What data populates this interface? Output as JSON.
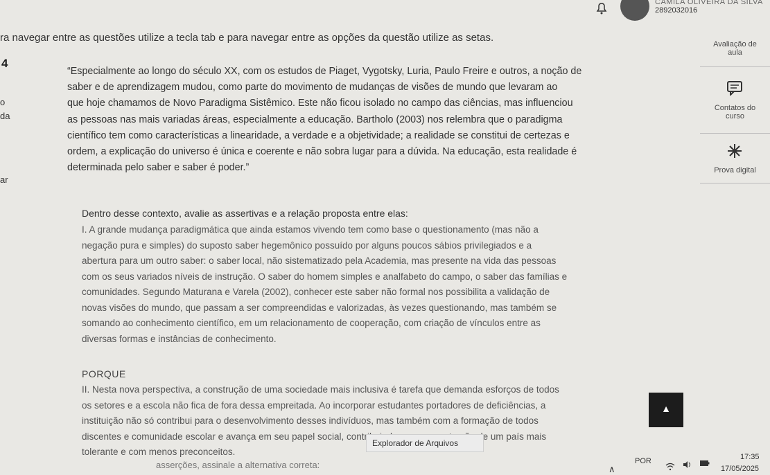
{
  "header": {
    "user_name": "CAMILA OLIVEIRA DA SILVA",
    "user_id": "2892032016"
  },
  "instructions": "ra navegar entre as questões utilize a tecla tab e para navegar entre as opções da questão utilize as setas.",
  "left_partial_labels": [
    "o",
    "da",
    "ar"
  ],
  "question": {
    "number": "4",
    "quote_lines": [
      "“Especialmente ao longo do século XX, com os estudos de Piaget, Vygotsky, Luria, Paulo Freire e outros, a noção de",
      "saber e de aprendizagem mudou, como parte do movimento de mudanças de visões de mundo que levaram ao",
      "que hoje chamamos de Novo Paradigma Sistêmico. Este não ficou isolado no campo das ciências, mas influenciou",
      "as pessoas nas mais variadas áreas, especialmente a educação. Bartholo (2003) nos relembra que o paradigma",
      "científico tem como características a linearidade, a verdade e a objetividade; a realidade se constitui de certezas e",
      "ordem, a explicação do universo é única e coerente e não sobra lugar para a dúvida. Na educação, esta realidade é",
      "determinada pelo saber e saber é poder.”"
    ],
    "context": "Dentro desse contexto, avalie as assertivas e a relação proposta entre elas:",
    "assertion1_lines": [
      "I. A grande mudança paradigmática que ainda estamos vivendo tem como base o questionamento (mas não a",
      "negação pura e simples) do suposto saber hegemônico possuído por alguns poucos sábios privilegiados e a",
      "abertura para um outro saber: o saber local, não sistematizado pela Academia, mas presente na vida das pessoas",
      "com os seus variados níveis de instrução. O saber do homem simples e analfabeto do campo, o saber das famílias e",
      "comunidades. Segundo Maturana e Varela (2002), conhecer este saber não formal nos possibilita a validação de",
      "novas visões do mundo, que passam a ser compreendidas e valorizadas, às vezes questionando, mas também se",
      "somando ao conhecimento científico, em um relacionamento de cooperação, com criação de vínculos entre as",
      "diversas formas e instâncias de conhecimento."
    ],
    "porque": "PORQUE",
    "assertion2_lines": [
      "II. Nesta nova perspectiva, a construção de uma sociedade mais inclusiva é tarefa que demanda esforços de todos",
      "os setores e a escola não fica de fora dessa empreitada. Ao incorporar estudantes portadores de deficiências, a",
      "instituição não só contribui para o desenvolvimento desses indivíduos, mas também com a formação de todos",
      "discentes e comunidade escolar e avança em seu papel social, contribuindo para a construção de um país mais",
      "tolerante e com menos preconceitos."
    ],
    "bottom_cut_text": "asserções, assinale a alternativa correta:"
  },
  "sidebar": {
    "items": [
      {
        "title": "Avaliação de",
        "subtitle": "aula"
      },
      {
        "title": "Contatos do",
        "subtitle": "curso"
      },
      {
        "title": "Prova digital",
        "subtitle": ""
      }
    ]
  },
  "scroll_up": {
    "label": "▲"
  },
  "tooltip": {
    "label": "Explorador de Arquivos"
  },
  "taskbar": {
    "language": "POR",
    "time": "17:35",
    "date": "17/05/2025",
    "overflow_icon": "∧"
  },
  "colors": {
    "background": "#e9e8e4",
    "text": "#333333",
    "scroll_button": "#1c1c1c"
  }
}
